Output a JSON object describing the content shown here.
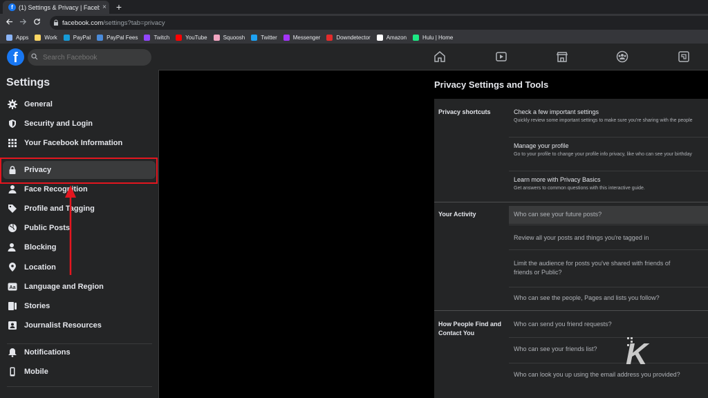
{
  "browser": {
    "tab_title": "(1) Settings & Privacy | Facebook",
    "tab_close": "×",
    "new_tab": "+",
    "url_host": "facebook.com",
    "url_path": "/settings?tab=privacy",
    "bookmarks": [
      {
        "label": "Apps",
        "color": "#8ab4f8"
      },
      {
        "label": "Work",
        "color": "#fdd663"
      },
      {
        "label": "PayPal",
        "color": "#169bd7"
      },
      {
        "label": "PayPal Fees",
        "color": "#4a8bdb"
      },
      {
        "label": "Twitch",
        "color": "#9146ff"
      },
      {
        "label": "YouTube",
        "color": "#ff0000"
      },
      {
        "label": "Squoosh",
        "color": "#f2a6c1"
      },
      {
        "label": "Twitter",
        "color": "#1da1f2"
      },
      {
        "label": "Messenger",
        "color": "#a334fa"
      },
      {
        "label": "Downdetector",
        "color": "#e32b2b"
      },
      {
        "label": "Amazon",
        "color": "#ffffff"
      },
      {
        "label": "Hulu | Home",
        "color": "#1ce783"
      }
    ]
  },
  "header": {
    "logo": "f",
    "search_placeholder": "Search Facebook"
  },
  "sidebar": {
    "title": "Settings",
    "items": [
      {
        "label": "General",
        "icon": "gear-icon"
      },
      {
        "label": "Security and Login",
        "icon": "shield-icon"
      },
      {
        "label": "Your Facebook Information",
        "icon": "grid-icon"
      },
      {
        "label": "Privacy",
        "icon": "lock-icon",
        "active": true
      },
      {
        "label": "Face Recognition",
        "icon": "person-icon"
      },
      {
        "label": "Profile and Tagging",
        "icon": "tag-icon"
      },
      {
        "label": "Public Posts",
        "icon": "globe-icon"
      },
      {
        "label": "Blocking",
        "icon": "block-person-icon"
      },
      {
        "label": "Location",
        "icon": "location-pin-icon"
      },
      {
        "label": "Language and Region",
        "icon": "language-icon"
      },
      {
        "label": "Stories",
        "icon": "book-icon"
      },
      {
        "label": "Journalist Resources",
        "icon": "journalist-icon"
      },
      {
        "label": "Notifications",
        "icon": "bell-icon"
      },
      {
        "label": "Mobile",
        "icon": "mobile-icon"
      }
    ]
  },
  "main": {
    "title": "Privacy Settings and Tools",
    "sections": [
      {
        "label": "Privacy shortcuts",
        "rows": [
          {
            "title": "Check a few important settings",
            "desc": "Quickly review some important settings to make sure you're sharing with the people"
          },
          {
            "title": "Manage your profile",
            "desc": "Go to your profile to change your profile info privacy, like who can see your birthday"
          },
          {
            "title": "Learn more with Privacy Basics",
            "desc": "Get answers to common questions with this interactive guide."
          }
        ]
      },
      {
        "label": "Your Activity",
        "rows": [
          {
            "title": "Who can see your future posts?"
          },
          {
            "title": "Review all your posts and things you're tagged in"
          },
          {
            "title": "Limit the audience for posts you've shared with friends of",
            "title2": "friends or Public?"
          },
          {
            "title": "Who can see the people, Pages and lists you follow?"
          }
        ]
      },
      {
        "label": "How People Find and Contact You",
        "rows": [
          {
            "title": "Who can send you friend requests?"
          },
          {
            "title": "Who can see your friends list?"
          },
          {
            "title": "Who can look you up using the email address you provided?"
          }
        ]
      }
    ]
  },
  "watermark": "K"
}
